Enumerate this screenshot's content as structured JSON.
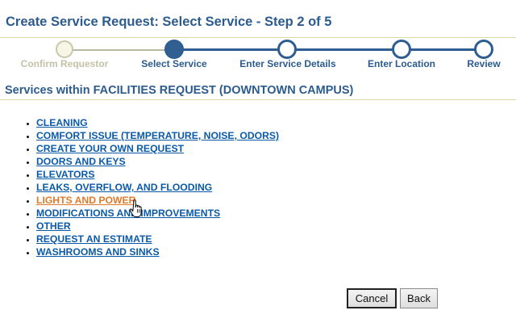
{
  "page": {
    "title": "Create Service Request:  Select Service - Step 2 of 5"
  },
  "wizard": {
    "steps": [
      {
        "label": "Confirm Requestor",
        "state": "complete"
      },
      {
        "label": "Select Service",
        "state": "current"
      },
      {
        "label": "Enter Service Details",
        "state": "future"
      },
      {
        "label": "Enter Location",
        "state": "future"
      },
      {
        "label": "Review",
        "state": "future"
      }
    ]
  },
  "section": {
    "heading": "Services within FACILITIES REQUEST (DOWNTOWN CAMPUS)"
  },
  "services": [
    {
      "label": "CLEANING"
    },
    {
      "label": "COMFORT ISSUE (TEMPERATURE, NOISE, ODORS)"
    },
    {
      "label": "CREATE YOUR OWN REQUEST"
    },
    {
      "label": "DOORS AND KEYS"
    },
    {
      "label": "ELEVATORS"
    },
    {
      "label": "LEAKS, OVERFLOW, AND FLOODING"
    },
    {
      "label": "LIGHTS AND POWER",
      "hovered": true
    },
    {
      "label": "MODIFICATIONS AND IMPROVEMENTS"
    },
    {
      "label": "OTHER"
    },
    {
      "label": "REQUEST AN ESTIMATE"
    },
    {
      "label": "WASHROOMS AND SINKS"
    }
  ],
  "buttons": {
    "cancel": "Cancel",
    "back": "Back"
  },
  "colors": {
    "primary": "#2c5b8e",
    "link": "#0b5aa8",
    "link_hover": "#e07a2a",
    "rule": "#d8d8a6",
    "completed_step": "#c3c2a6"
  },
  "icons": {
    "cursor": "hand-pointer-icon"
  }
}
